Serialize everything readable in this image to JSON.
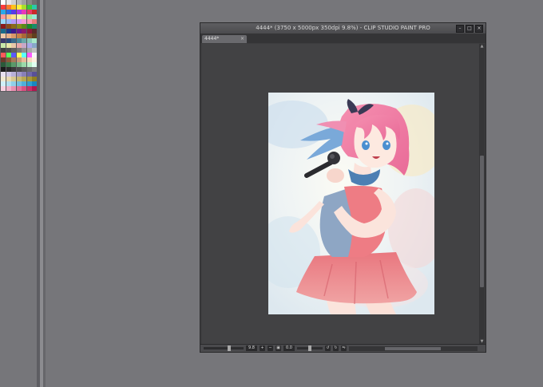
{
  "window": {
    "title": "4444* (3750 x 5000px 350dpi 9.8%)  - CLIP STUDIO PAINT PRO",
    "tab_label": "4444*",
    "tab_close": "×",
    "buttons": {
      "minimize": "–",
      "maximize": "□",
      "close": "×"
    }
  },
  "statusbar": {
    "zoom_value": "9.8",
    "rotation_value": "0.0"
  },
  "palette": {
    "colors": [
      "#ffffff",
      "#e8e8e8",
      "#d0d0d0",
      "#b8b8b8",
      "#a0a0a0",
      "#888888",
      "#707070",
      "#ff3b3b",
      "#ff7a2a",
      "#ffc21a",
      "#fff23a",
      "#a8e02a",
      "#3ac83a",
      "#2ac8a8",
      "#2aa8e8",
      "#2a6ae8",
      "#5a3ae8",
      "#a83ae8",
      "#e83ab8",
      "#e83a6a",
      "#c82a2a",
      "#ff9a9a",
      "#ffbf8a",
      "#ffe08a",
      "#fff7a8",
      "#d4f29a",
      "#9ae89a",
      "#9ae8d8",
      "#9ad8f8",
      "#9ab8f8",
      "#b49af8",
      "#d89af8",
      "#f89ad8",
      "#f89ab4",
      "#e87a7a",
      "#8a1a1a",
      "#8a4a1a",
      "#8a6a1a",
      "#8a8a1a",
      "#5a8a1a",
      "#1a8a2a",
      "#1a8a6a",
      "#1a6a8a",
      "#1a3a8a",
      "#3a1a8a",
      "#6a1a8a",
      "#8a1a6a",
      "#8a1a3a",
      "#5a2a2a",
      "#f0c8a8",
      "#e8b088",
      "#d89868",
      "#c88048",
      "#a86838",
      "#885028",
      "#604020",
      "#3a3a6a",
      "#2a4a7a",
      "#3a6a8a",
      "#4a8a9a",
      "#6aa8a8",
      "#8ac8b8",
      "#a8e8c8",
      "#c8e8a8",
      "#e8e8a8",
      "#e8c8a8",
      "#e8a8a8",
      "#c8a8c8",
      "#a8a8e8",
      "#88a8c8",
      "#404040",
      "#505050",
      "#606060",
      "#787878",
      "#909090",
      "#a8a8a8",
      "#c0c0c0",
      "#ff5a5a",
      "#5aff5a",
      "#5a5aff",
      "#ffff5a",
      "#5affff",
      "#ff5aff",
      "#f8f8f8",
      "#6a3a2a",
      "#8a5a3a",
      "#a87a5a",
      "#c89a7a",
      "#e8ba9a",
      "#f8d8c0",
      "#fff0e0",
      "#2a5a3a",
      "#3a7a4a",
      "#5a9a6a",
      "#7aba8a",
      "#9adaaa",
      "#baf0c8",
      "#e0fff0",
      "#1a1a1a",
      "#2a2a2a",
      "#3a3a3a",
      "#4a4a4a",
      "#5a5a5a",
      "#6a6a6a",
      "#7a7a7a",
      "#e8e0f0",
      "#d0c8e8",
      "#b8b0d8",
      "#a098c8",
      "#8880b8",
      "#7068a8",
      "#585098",
      "#f0e8d0",
      "#e8d8b0",
      "#d8c890",
      "#c8b870",
      "#b8a850",
      "#a89838",
      "#908020",
      "#d0f0f8",
      "#b0e0f0",
      "#90d0e8",
      "#70c0e0",
      "#50b0d8",
      "#30a0d0",
      "#1888c0",
      "#f8d0e0",
      "#f0b0c8",
      "#e890b0",
      "#e07098",
      "#d85080",
      "#c83068",
      "#b01850"
    ]
  }
}
